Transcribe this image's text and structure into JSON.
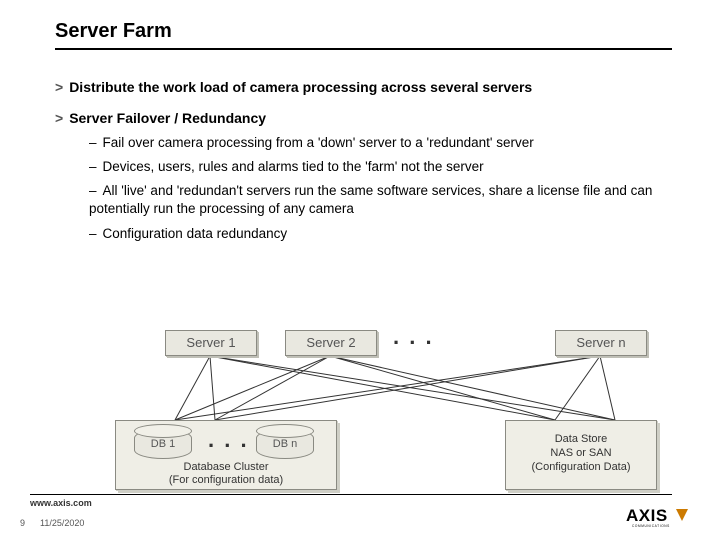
{
  "title": "Server Farm",
  "bullets": {
    "p1": "Distribute the work load of camera processing across several servers",
    "p2": "Server Failover / Redundancy",
    "s1": "Fail over camera processing from a 'down' server to a 'redundant' server",
    "s2": "Devices, users, rules and alarms tied to the 'farm' not the server",
    "s3": "All 'live' and 'redundan't servers run the same software services, share a license file and can potentially run the processing of any camera",
    "s4": "Configuration data redundancy"
  },
  "diagram": {
    "server1": "Server 1",
    "server2": "Server 2",
    "servern": "Server n",
    "ell_top": ". . .",
    "db1": "DB 1",
    "dbn": "DB n",
    "ell_mid": ". . .",
    "cluster_caption_l1": "Database Cluster",
    "cluster_caption_l2": "(For configuration data)",
    "ds_l1": "Data Store",
    "ds_l2": "NAS or SAN",
    "ds_l3": "(Configuration Data)"
  },
  "footer": {
    "url": "www.axis.com",
    "page": "9",
    "date": "11/25/2020",
    "logo_word": "AXIS",
    "logo_tag": "COMMUNICATIONS"
  }
}
